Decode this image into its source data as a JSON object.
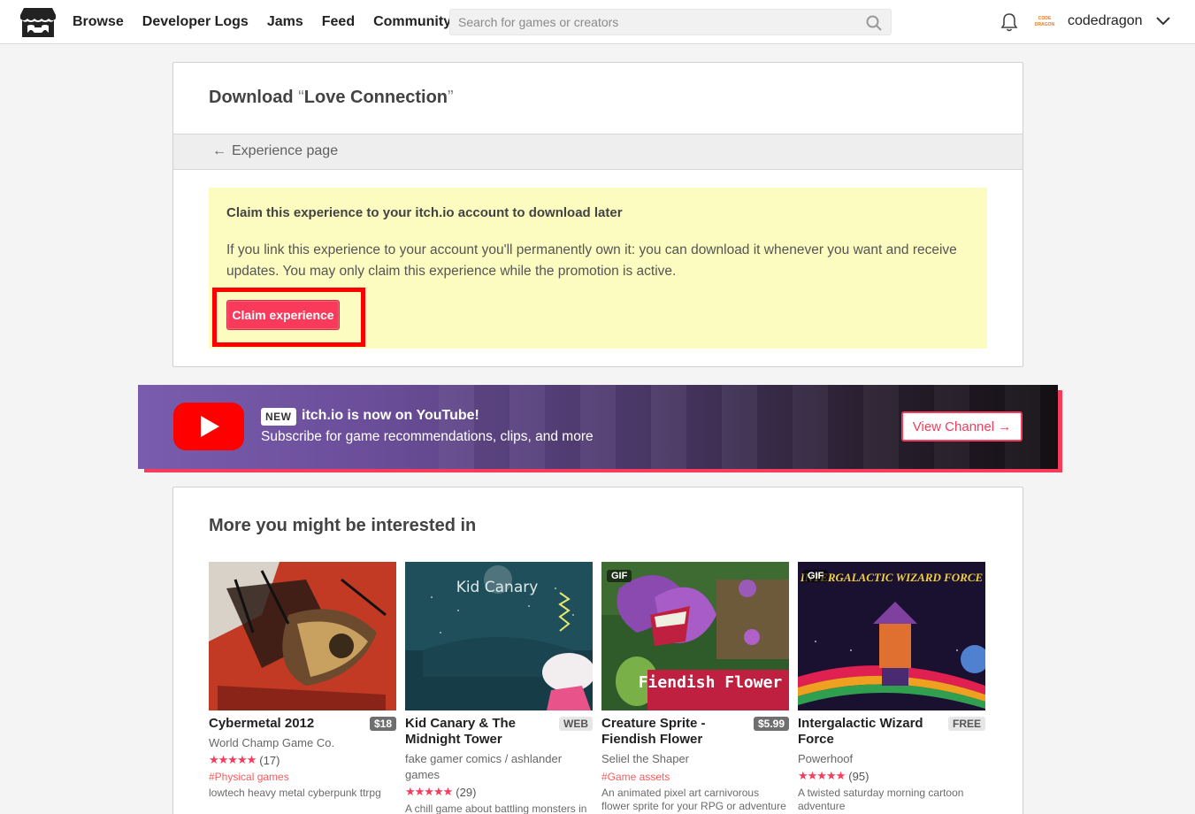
{
  "nav": {
    "links": [
      "Browse",
      "Developer Logs",
      "Jams",
      "Feed",
      "Community"
    ],
    "search_placeholder": "Search for games or creators",
    "username": "codedragon",
    "avatar_text": "CODE DRAGON"
  },
  "download": {
    "title_prefix": "Download ",
    "open_quote": "“",
    "title_name": "Love Connection",
    "close_quote": "”",
    "back_arrow": "←",
    "back_label": "Experience page",
    "claim_heading": "Claim this experience to your itch.io account to download later",
    "claim_text": "If you link this experience to your account you'll permanently own it: you can download it whenever you want and receive updates. You may only claim this experience while the promotion is active.",
    "claim_button": "Claim experience"
  },
  "banner": {
    "badge": "NEW",
    "title": "itch.io is now on YouTube!",
    "subtitle": "Subscribe for game recommendations, clips, and more",
    "button": "View Channel →"
  },
  "recommendations": {
    "title": "More you might be interested in",
    "games": [
      {
        "title": "Cybermetal 2012",
        "price": "$18",
        "author": "World Champ Game Co.",
        "stars": "★★★★★",
        "rating": "(17)",
        "tag": "#Physical games",
        "desc": "lowtech heavy metal cyberpunk ttrpg",
        "gif": "",
        "thumb_text": ""
      },
      {
        "title": "Kid Canary & The Midnight Tower",
        "price": "WEB",
        "author": "fake gamer comics / ashlander games",
        "stars": "★★★★★",
        "rating": "(29)",
        "tag": "",
        "desc": "A chill game about battling monsters in",
        "gif": "",
        "thumb_text": "Kid Canary"
      },
      {
        "title": "Creature Sprite - Fiendish Flower",
        "price": "$5.99",
        "author": "Seliel the Shaper",
        "stars": "",
        "rating": "",
        "tag": "#Game assets",
        "desc": "An animated pixel art carnivorous flower sprite for your RPG or adventure",
        "gif": "GIF",
        "thumb_text": "Fiendish Flower"
      },
      {
        "title": "Intergalactic Wizard Force",
        "price": "FREE",
        "author": "Powerhoof",
        "stars": "★★★★★",
        "rating": "(95)",
        "tag": "",
        "desc": "A twisted saturday morning cartoon adventure",
        "gif": "GIF",
        "thumb_text": "INTERGALACTIC WIZARD FORCE"
      }
    ]
  }
}
